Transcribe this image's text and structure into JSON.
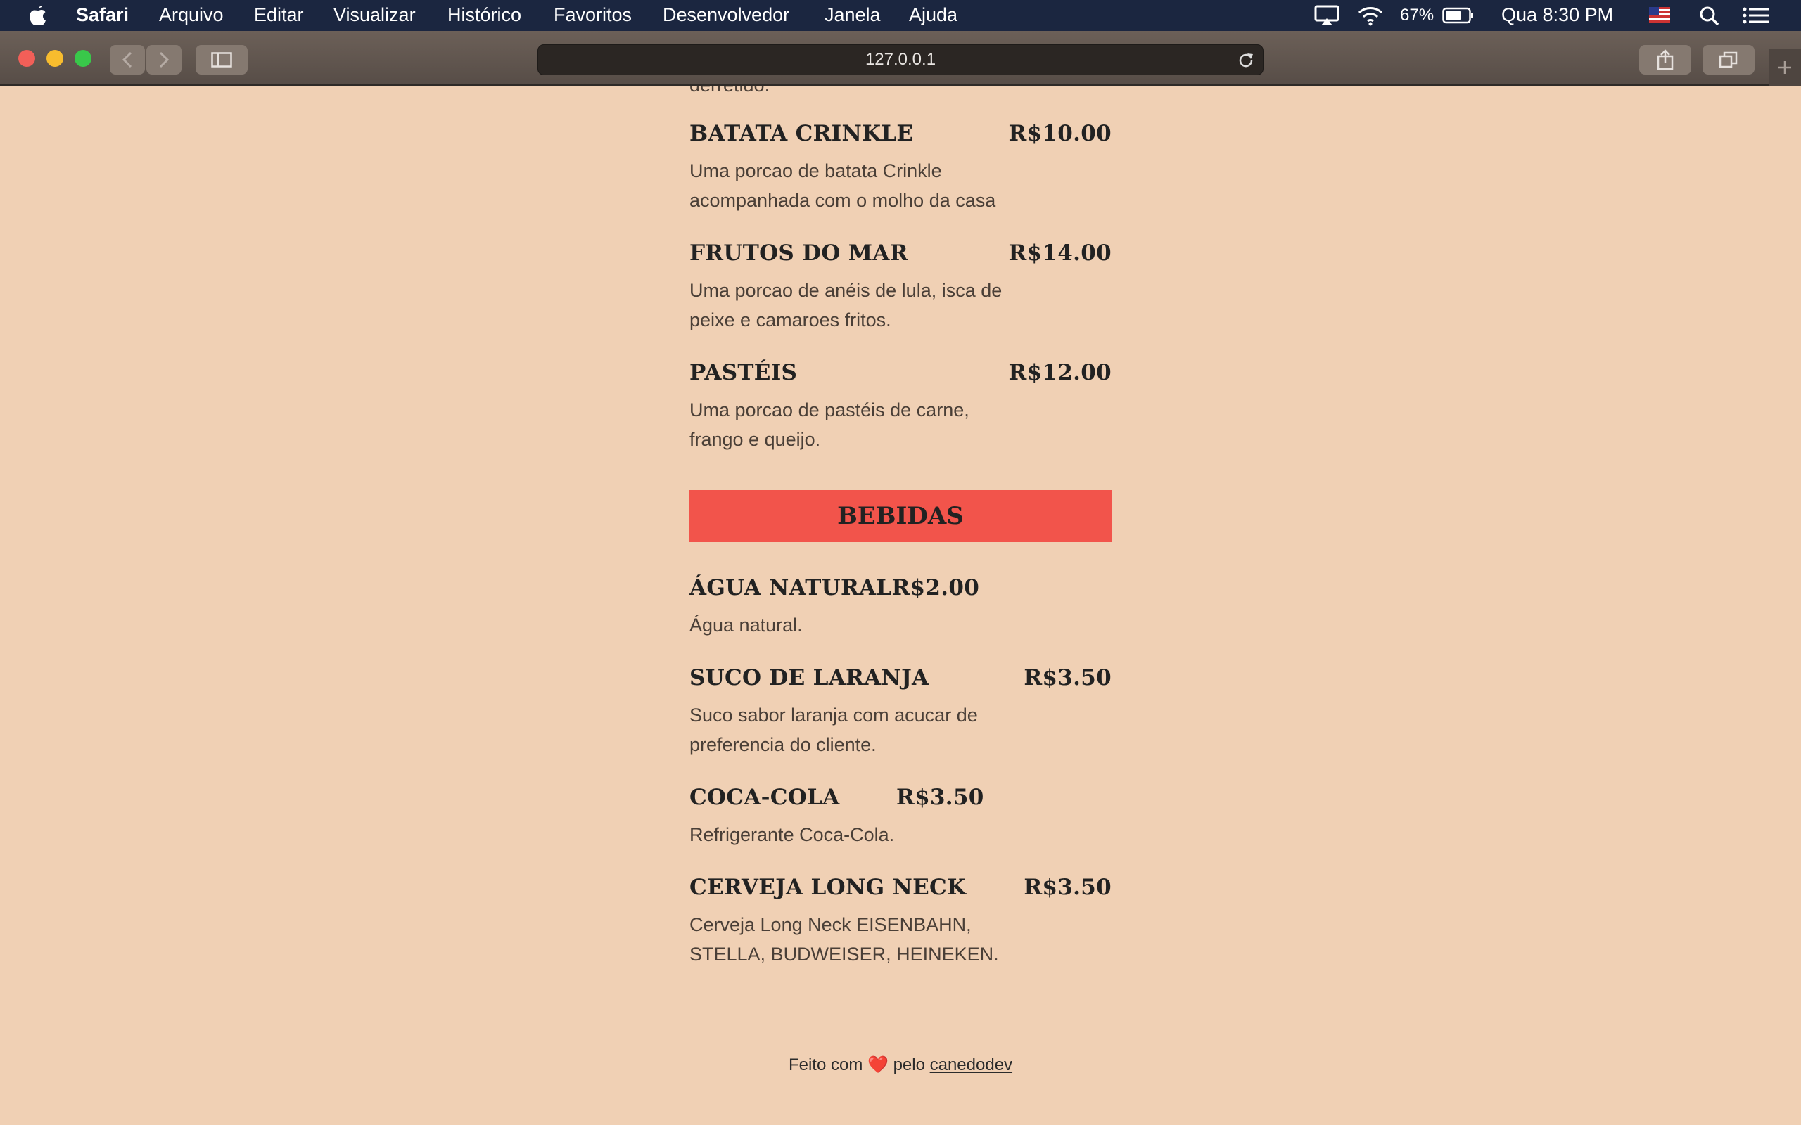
{
  "menubar": {
    "app_name": "Safari",
    "menus": [
      "Arquivo",
      "Editar",
      "Visualizar",
      "Histórico",
      "Favoritos",
      "Desenvolvedor",
      "Janela",
      "Ajuda"
    ],
    "battery": "67%",
    "clock": "Qua 8:30 PM"
  },
  "browser": {
    "url": "127.0.0.1"
  },
  "page": {
    "cut_text": "derretido.",
    "items": [
      {
        "name": "BATATA CRINKLE",
        "price": "R$10.00",
        "desc": "Uma porcao de batata Crinkle acompanhada com o molho da casa"
      },
      {
        "name": "FRUTOS DO MAR",
        "price": "R$14.00",
        "desc": "Uma porcao de anéis de lula, isca de peixe e camaroes fritos."
      },
      {
        "name": "PASTÉIS",
        "price": "R$12.00",
        "desc": "Uma porcao de pastéis de carne, frango e queijo."
      }
    ],
    "section_title": "BEBIDAS",
    "drinks": [
      {
        "name": "ÁGUA NATURAL",
        "price": "R$2.00",
        "desc": "Água natural."
      },
      {
        "name": "SUCO DE LARANJA",
        "price": "R$3.50",
        "desc": "Suco sabor laranja com acucar de preferencia do cliente."
      },
      {
        "name": "COCA-COLA",
        "price": "R$3.50",
        "desc": "Refrigerante Coca-Cola."
      },
      {
        "name": "CERVEJA LONG NECK",
        "price": "R$3.50",
        "desc": "Cerveja Long Neck EISENBAHN, STELLA, BUDWEISER, HEINEKEN."
      }
    ],
    "footer": {
      "prefix": "Feito com",
      "heart": "❤️",
      "middle": "pelo",
      "author": "canedodev"
    }
  }
}
